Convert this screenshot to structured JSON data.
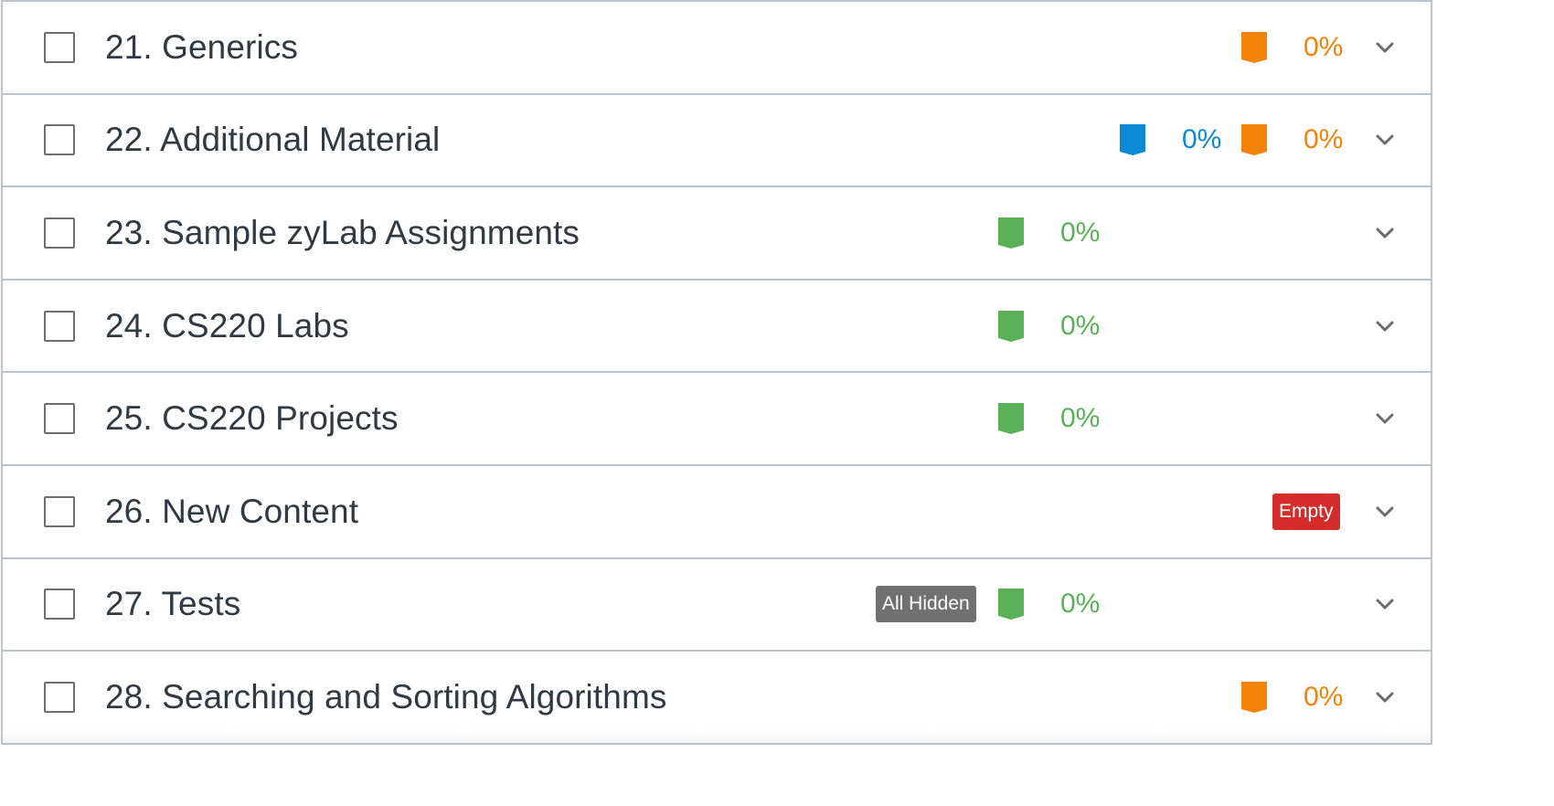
{
  "colors": {
    "orange": "#f38209",
    "blue": "#0c88d4",
    "green": "#5ab158",
    "empty_badge": "#d42b2b",
    "hidden_badge": "#717171",
    "title_text": "#2f3a44",
    "divider": "#b9c4cc"
  },
  "chapters": [
    {
      "title": "21. Generics",
      "orange_pct": "0%"
    },
    {
      "title": "22. Additional Material",
      "blue_pct": "0%",
      "orange_pct": "0%"
    },
    {
      "title": "23. Sample zyLab Assignments",
      "green_pct": "0%"
    },
    {
      "title": "24. CS220 Labs",
      "green_pct": "0%"
    },
    {
      "title": "25. CS220 Projects",
      "green_pct": "0%"
    },
    {
      "title": "26. New Content",
      "badge": "Empty"
    },
    {
      "title": "27. Tests",
      "badge": "All Hidden",
      "green_pct": "0%"
    },
    {
      "title": "28. Searching and Sorting Algorithms",
      "orange_pct": "0%"
    }
  ]
}
